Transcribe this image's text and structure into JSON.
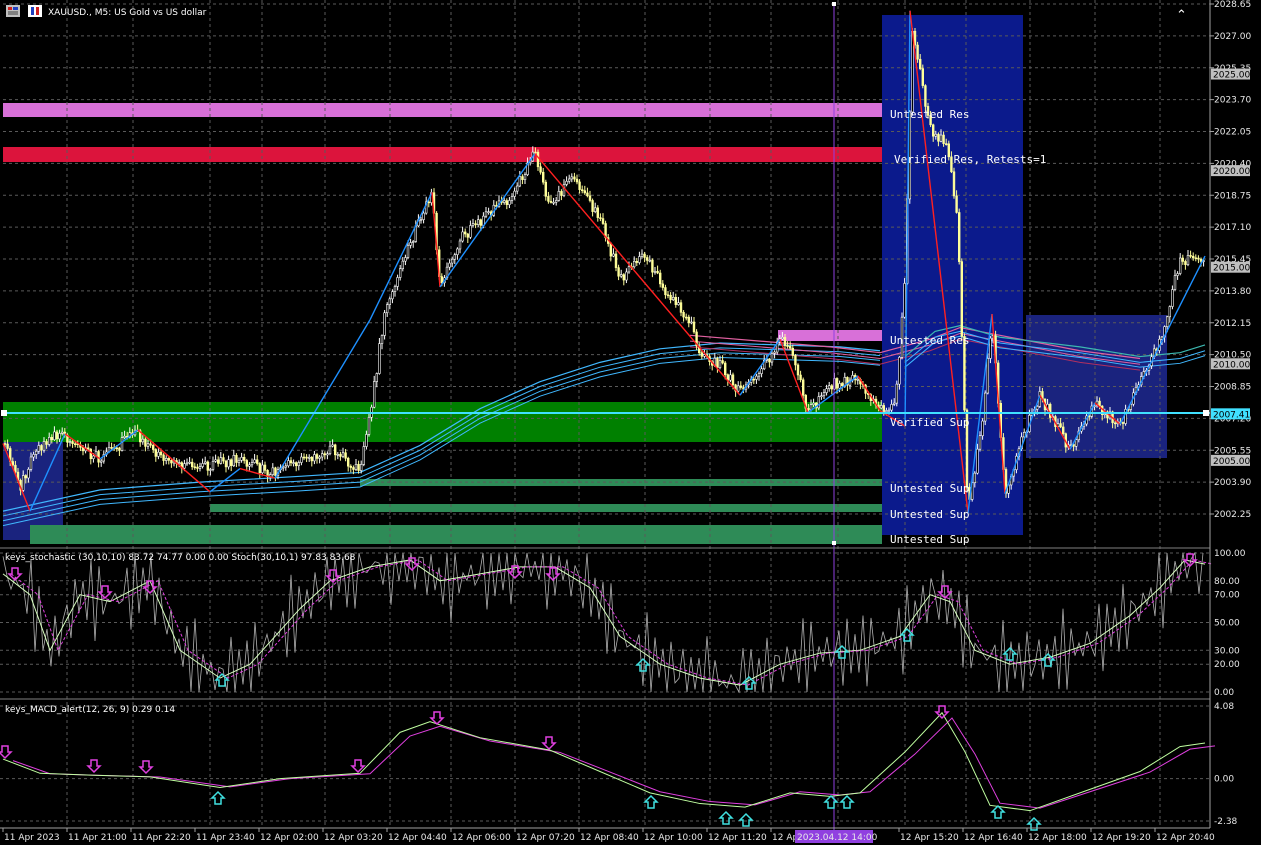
{
  "header": {
    "symbol_title": "XAUUSD., M5:  US Gold vs US dollar"
  },
  "stoch_panel": {
    "title": "keys_stochastic (30,10,10) 83.72 74.77 0.00 0.00 Stoch(30,10,1) 97.83 83.68",
    "levels": [
      "100.00",
      "80.00",
      "70.00",
      "50.00",
      "30.00",
      "20.00",
      "0.00"
    ]
  },
  "macd_panel": {
    "title": "keys_MACD_alert(12, 26, 9) 0.29 0.14",
    "levels": [
      "4.08",
      "0.00",
      "-2.38"
    ]
  },
  "price_axis": {
    "labels": [
      "2028.65",
      "2027.00",
      "2025.35",
      "2023.70",
      "2022.05",
      "2020.40",
      "2018.75",
      "2017.10",
      "2015.45",
      "2013.80",
      "2012.15",
      "2010.50",
      "2008.85",
      "2007.20",
      "2005.55",
      "2003.90",
      "2002.25"
    ],
    "tags": [
      {
        "price": "2025.00",
        "color": "#c0c0c0"
      },
      {
        "price": "2020.00",
        "color": "#c0c0c0"
      },
      {
        "price": "2015.00",
        "color": "#c0c0c0"
      },
      {
        "price": "2010.00",
        "color": "#c0c0c0"
      },
      {
        "price": "2007.41",
        "color": "#40e0ff"
      },
      {
        "price": "2005.00",
        "color": "#c0c0c0"
      }
    ]
  },
  "time_axis": {
    "labels": [
      "11 Apr 2023",
      "11 Apr 21:00",
      "11 Apr 22:20",
      "11 Apr 23:40",
      "12 Apr 02:00",
      "12 Apr 03:20",
      "12 Apr 04:40",
      "12 Apr 06:00",
      "12 Apr 07:20",
      "12 Apr 08:40",
      "12 Apr 10:00",
      "12 Apr 11:20",
      "12 Apr",
      "12 Apr 15:20",
      "12 Apr 16:40",
      "12 Apr 18:00",
      "12 Apr 19:20",
      "12 Apr 20:40"
    ],
    "cursor_label": "2023.04.12 14:00"
  },
  "zones": [
    {
      "label": "Untested Res",
      "kind": "untested-res"
    },
    {
      "label": "Verified Res, Retests=1",
      "kind": "verified-res"
    },
    {
      "label": "Untested Res",
      "kind": "untested-res"
    },
    {
      "label": "Verified Sup",
      "kind": "verified-sup"
    },
    {
      "label": "Untested Sup",
      "kind": "untested-sup"
    },
    {
      "label": "Untested Sup",
      "kind": "untested-sup"
    },
    {
      "label": "Untested Sup",
      "kind": "untested-sup"
    }
  ],
  "colors": {
    "background": "#000000",
    "bull_candle": "#ffffff",
    "bear_candle": "#ffff9a",
    "untested_res": "#d870d8",
    "verified_res": "#dc143c",
    "verified_sup": "#008000",
    "untested_sup": "#2e8b57",
    "session_box": "#00008b",
    "zigzag_up": "#1e90ff",
    "zigzag_down": "#ff2020",
    "ma": "#40b8ff",
    "ma2": "#e060a0",
    "hline": "#40e0ff",
    "cursor": "#9040e0",
    "arrow_up": "#40e0e0",
    "arrow_down": "#e040e0"
  }
}
